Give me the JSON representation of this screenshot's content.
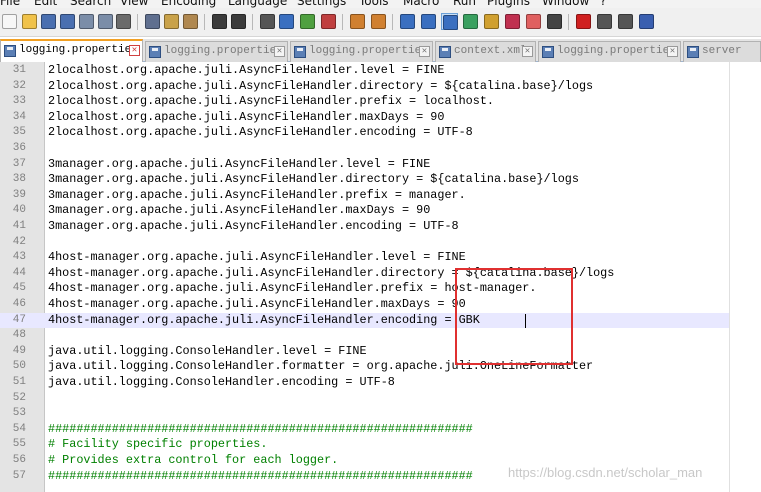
{
  "menu": [
    "File",
    "Edit",
    "Search",
    "View",
    "Encoding",
    "Language",
    "Settings",
    "Tools",
    "Macro",
    "Run",
    "Plugins",
    "Window",
    "?"
  ],
  "toolbar": {
    "buttons": [
      {
        "name": "new-file-icon",
        "color": "#f7f7f7"
      },
      {
        "name": "open-file-icon",
        "color": "#f0c24a"
      },
      {
        "name": "save-icon",
        "color": "#4a6fb0"
      },
      {
        "name": "save-all-icon",
        "color": "#4a6fb0"
      },
      {
        "name": "close-icon",
        "color": "#7b8da8"
      },
      {
        "name": "close-all-icon",
        "color": "#7b8da8"
      },
      {
        "name": "print-icon",
        "color": "#6b6b6b"
      },
      {
        "name": "cut-icon",
        "color": "#5f6f8f"
      },
      {
        "name": "copy-icon",
        "color": "#c9a24a"
      },
      {
        "name": "paste-icon",
        "color": "#b08850"
      },
      {
        "name": "undo-icon",
        "color": "#3b3b3b"
      },
      {
        "name": "redo-icon",
        "color": "#3b3b3b"
      },
      {
        "name": "find-icon",
        "color": "#555555"
      },
      {
        "name": "replace-icon",
        "color": "#3a6fc0"
      },
      {
        "name": "zoom-in-icon",
        "color": "#4fa040"
      },
      {
        "name": "zoom-out-icon",
        "color": "#c04040"
      },
      {
        "name": "sync-vertical-icon",
        "color": "#d08030"
      },
      {
        "name": "sync-horizontal-icon",
        "color": "#d08030"
      },
      {
        "name": "word-wrap-icon",
        "color": "#3a6fc0"
      },
      {
        "name": "show-all-chars-icon",
        "color": "#3a6fc0"
      },
      {
        "name": "indent-guide-icon",
        "color": "#3a6fc0"
      },
      {
        "name": "user-language-icon",
        "color": "#3aa060"
      },
      {
        "name": "doc-map-icon",
        "color": "#d0a030"
      },
      {
        "name": "function-list-icon",
        "color": "#c03050"
      },
      {
        "name": "folder-workspace-icon",
        "color": "#e06060"
      },
      {
        "name": "monitoring-icon",
        "color": "#444444"
      },
      {
        "name": "record-macro-icon",
        "color": "#d02020"
      },
      {
        "name": "stop-record-icon",
        "color": "#555555"
      },
      {
        "name": "play-macro-icon",
        "color": "#555555"
      },
      {
        "name": "run-macro-multiple-icon",
        "color": "#3a5fb0"
      }
    ]
  },
  "tabs": [
    {
      "label": "logging.properties",
      "active": true
    },
    {
      "label": "logging.properties",
      "active": false
    },
    {
      "label": "logging.properties",
      "active": false
    },
    {
      "label": "context.xml",
      "active": false
    },
    {
      "label": "logging.properties",
      "active": false
    },
    {
      "label": "server",
      "active": false
    }
  ],
  "editor": {
    "current_line": 47,
    "lines": [
      {
        "n": "31",
        "text": "2localhost.org.apache.juli.AsyncFileHandler.level = FINE"
      },
      {
        "n": "32",
        "text": "2localhost.org.apache.juli.AsyncFileHandler.directory = ${catalina.base}/logs"
      },
      {
        "n": "33",
        "text": "2localhost.org.apache.juli.AsyncFileHandler.prefix = localhost."
      },
      {
        "n": "34",
        "text": "2localhost.org.apache.juli.AsyncFileHandler.maxDays = 90"
      },
      {
        "n": "35",
        "text": "2localhost.org.apache.juli.AsyncFileHandler.encoding = UTF-8"
      },
      {
        "n": "36",
        "text": ""
      },
      {
        "n": "37",
        "text": "3manager.org.apache.juli.AsyncFileHandler.level = FINE"
      },
      {
        "n": "38",
        "text": "3manager.org.apache.juli.AsyncFileHandler.directory = ${catalina.base}/logs"
      },
      {
        "n": "39",
        "text": "3manager.org.apache.juli.AsyncFileHandler.prefix = manager."
      },
      {
        "n": "40",
        "text": "3manager.org.apache.juli.AsyncFileHandler.maxDays = 90"
      },
      {
        "n": "41",
        "text": "3manager.org.apache.juli.AsyncFileHandler.encoding = UTF-8"
      },
      {
        "n": "42",
        "text": ""
      },
      {
        "n": "43",
        "text": "4host-manager.org.apache.juli.AsyncFileHandler.level = FINE"
      },
      {
        "n": "44",
        "text": "4host-manager.org.apache.juli.AsyncFileHandler.directory = ${catalina.base}/logs"
      },
      {
        "n": "45",
        "text": "4host-manager.org.apache.juli.AsyncFileHandler.prefix = host-manager."
      },
      {
        "n": "46",
        "text": "4host-manager.org.apache.juli.AsyncFileHandler.maxDays = 90"
      },
      {
        "n": "47",
        "text": "4host-manager.org.apache.juli.AsyncFileHandler.encoding = GBK"
      },
      {
        "n": "48",
        "text": ""
      },
      {
        "n": "49",
        "text": "java.util.logging.ConsoleHandler.level = FINE"
      },
      {
        "n": "50",
        "text": "java.util.logging.ConsoleHandler.formatter = org.apache.juli.OneLineFormatter"
      },
      {
        "n": "51",
        "text": "java.util.logging.ConsoleHandler.encoding = UTF-8"
      },
      {
        "n": "52",
        "text": ""
      },
      {
        "n": "53",
        "text": ""
      },
      {
        "n": "54",
        "text": "############################################################",
        "comment": true
      },
      {
        "n": "55",
        "text": "# Facility specific properties.",
        "comment": true
      },
      {
        "n": "56",
        "text": "# Provides extra control for each logger.",
        "comment": true
      },
      {
        "n": "57",
        "text": "############################################################",
        "comment": true
      }
    ]
  },
  "watermark": "https://blog.csdn.net/scholar_man",
  "colors": {
    "highlight_box": "#e03030",
    "comment": "#008000",
    "current_line_bg": "#e8e8ff",
    "active_tab_accent": "#f2a023"
  }
}
